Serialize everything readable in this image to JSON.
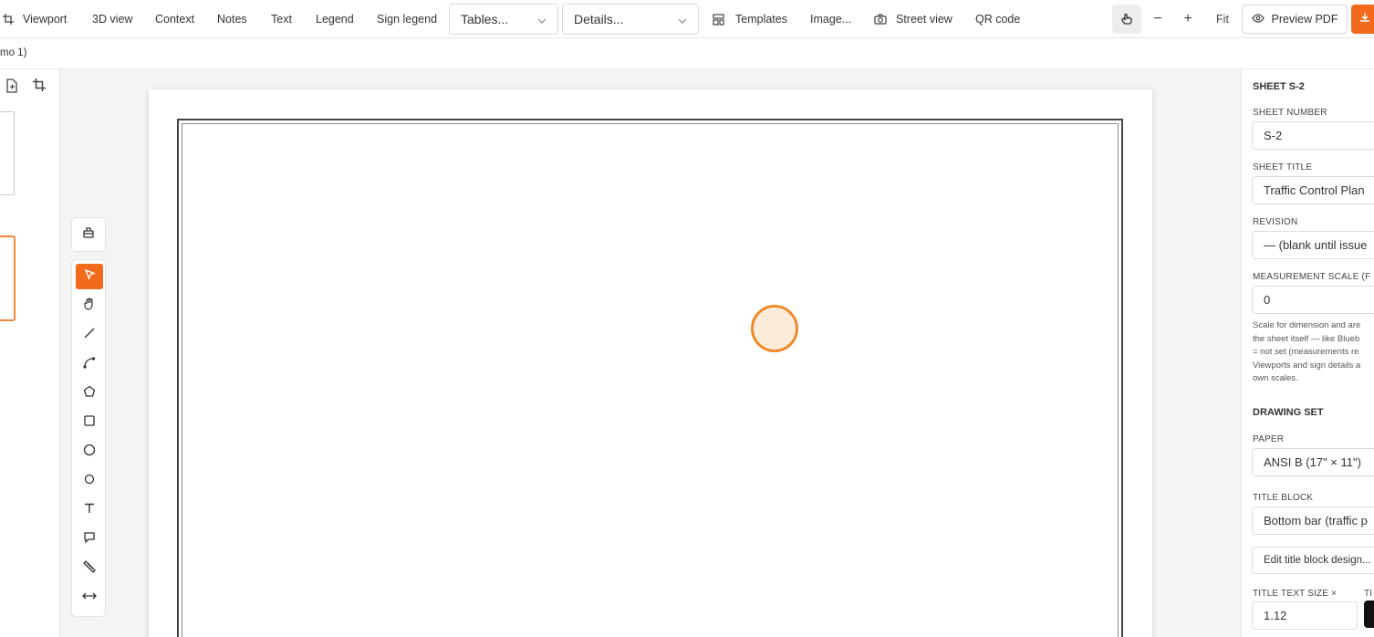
{
  "toolbar": {
    "items": [
      "Viewport",
      "3D view",
      "Context",
      "Notes",
      "Text",
      "Legend",
      "Sign legend"
    ],
    "tables_label": "Tables...",
    "details_label": "Details...",
    "templates": "Templates",
    "image": "Image...",
    "street_view": "Street view",
    "qr_code": "QR code",
    "zoom_out": "−",
    "zoom_in": "+",
    "fit": "Fit",
    "preview_pdf": "Preview PDF"
  },
  "subbar": {
    "text": "mo 1)"
  },
  "tools": [
    "select-tool",
    "pan-tool",
    "line-tool",
    "arc-tool",
    "polygon-tool",
    "rectangle-tool",
    "circle-tool",
    "ellipse-tool",
    "text-tool",
    "callout-tool",
    "measure-tool",
    "dimension-tool"
  ],
  "panel": {
    "sheet_heading": "SHEET S-2",
    "sheet_number_label": "SHEET NUMBER",
    "sheet_number_value": "S-2",
    "sheet_title_label": "SHEET TITLE",
    "sheet_title_value": "Traffic Control Plan",
    "revision_label": "REVISION",
    "revision_value": "— (blank until issue",
    "scale_label": "MEASUREMENT SCALE (F",
    "scale_value": "0",
    "help_lines": [
      "Scale for dimension and are",
      "the sheet itself — like Blueb",
      "= not set (measurements re",
      "Viewports and sign details a",
      "own scales."
    ],
    "drawing_set_heading": "DRAWING SET",
    "paper_label": "PAPER",
    "paper_value": "ANSI B (17\" × 11\")",
    "title_block_label": "TITLE BLOCK",
    "title_block_value": "Bottom bar (traffic p",
    "edit_title_block": "Edit title block design...",
    "title_text_size_label": "TITLE TEXT SIZE ×",
    "title_text_size_value": "1.12",
    "second_label": "TI"
  },
  "colors": {
    "accent": "#f26b1d",
    "cursor_ring": "#ef8a2a"
  }
}
